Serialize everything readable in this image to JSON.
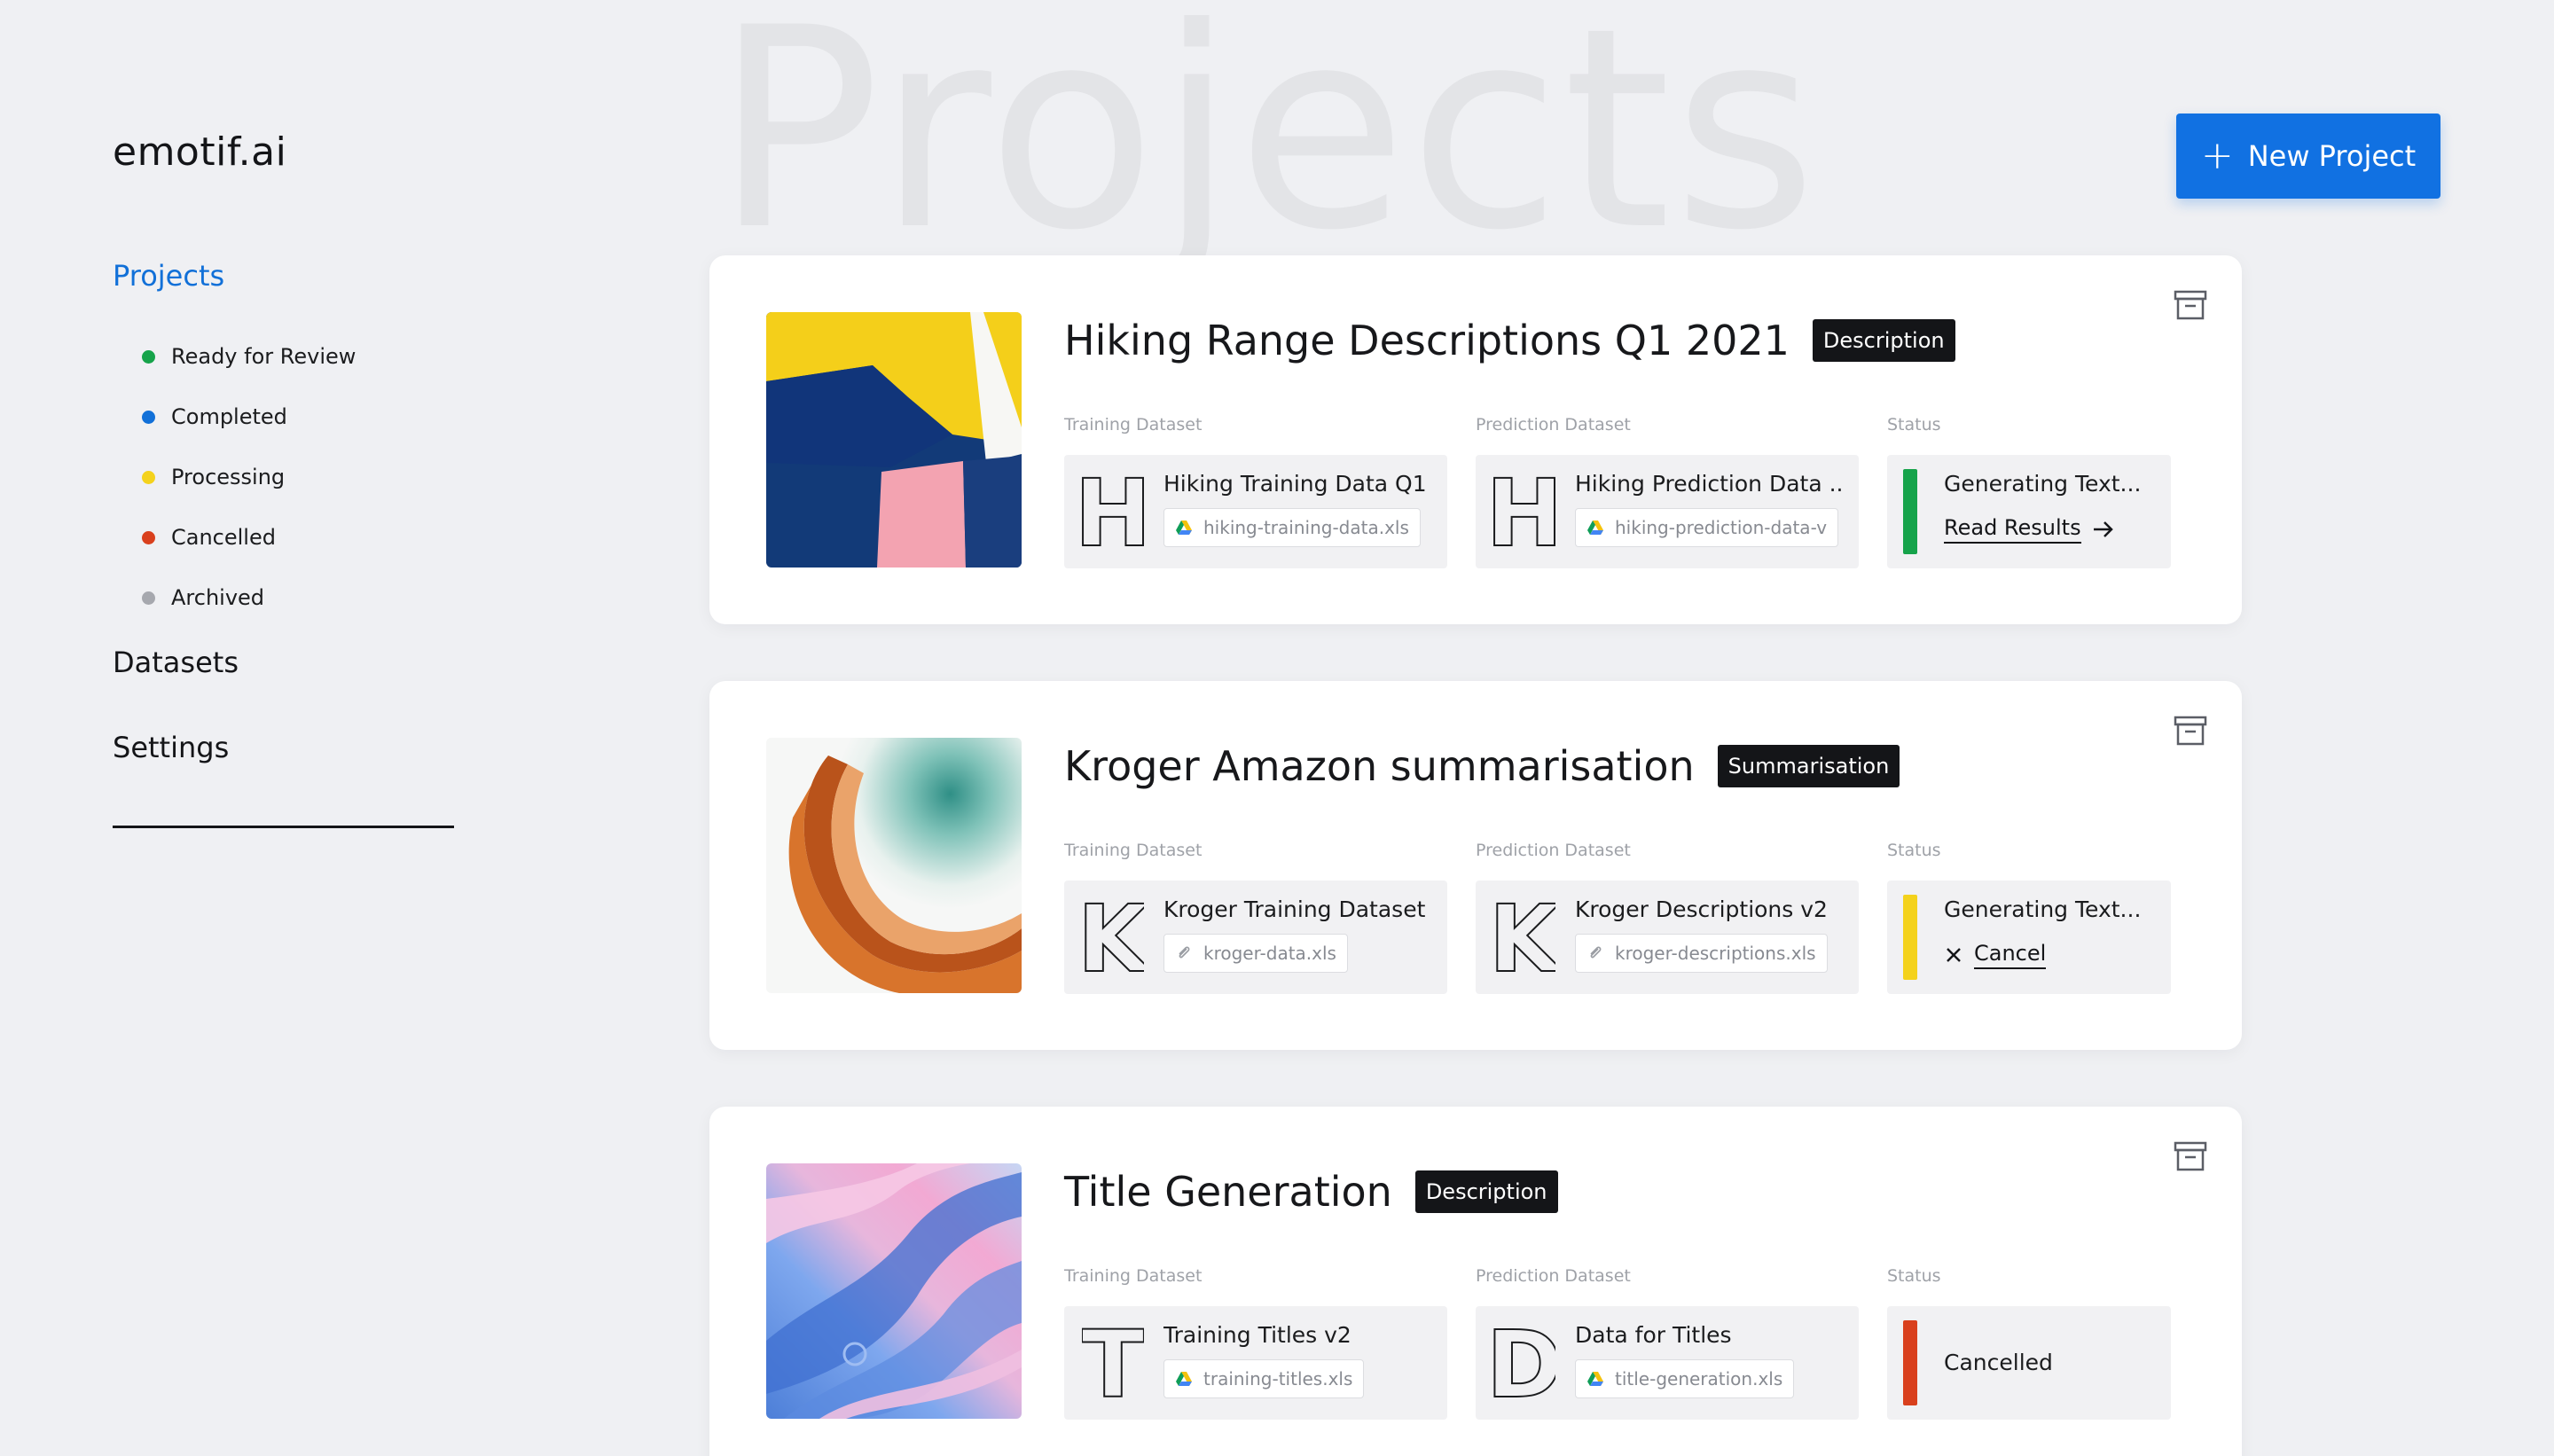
{
  "brand": "emotif.ai",
  "page_title": "Projects",
  "new_project_label": "New Project",
  "nav": {
    "projects": "Projects",
    "filters": [
      {
        "label": "Ready for Review",
        "color": "#16a34a"
      },
      {
        "label": "Completed",
        "color": "#1170d8"
      },
      {
        "label": "Processing",
        "color": "#f4d21c"
      },
      {
        "label": "Cancelled",
        "color": "#d9401d"
      },
      {
        "label": "Archived",
        "color": "#a6a8ae"
      }
    ],
    "datasets": "Datasets",
    "settings": "Settings"
  },
  "labels": {
    "training": "Training Dataset",
    "prediction": "Prediction Dataset",
    "status": "Status"
  },
  "projects": [
    {
      "title": "Hiking Range Descriptions Q1 2021",
      "tag": "Description",
      "training": {
        "letter": "H",
        "name": "Hiking Training Data Q1 ...",
        "file": "hiking-training-data.xls",
        "file_icon": "google-drive-icon"
      },
      "prediction": {
        "letter": "H",
        "name": "Hiking Prediction Data ...",
        "file": "hiking-prediction-data-v",
        "file_icon": "google-drive-icon"
      },
      "status": {
        "text": "Generating Text...",
        "color": "#16a34a",
        "action": "Read Results",
        "action_icon": "arrow-right-icon"
      }
    },
    {
      "title": "Kroger Amazon summarisation",
      "tag": "Summarisation",
      "training": {
        "letter": "K",
        "name": "Kroger Training Dataset",
        "file": "kroger-data.xls",
        "file_icon": "paperclip-icon"
      },
      "prediction": {
        "letter": "K",
        "name": "Kroger Descriptions v2",
        "file": "kroger-descriptions.xls",
        "file_icon": "paperclip-icon"
      },
      "status": {
        "text": "Generating Text...",
        "color": "#f4d21c",
        "action": "Cancel",
        "action_icon": "close-icon"
      }
    },
    {
      "title": "Title Generation",
      "tag": "Description",
      "training": {
        "letter": "T",
        "name": "Training Titles v2",
        "file": "training-titles.xls",
        "file_icon": "google-drive-icon"
      },
      "prediction": {
        "letter": "D",
        "name": "Data for Titles",
        "file": "title-generation.xls",
        "file_icon": "google-drive-icon"
      },
      "status": {
        "text": "Cancelled",
        "color": "#d9401d",
        "action": "",
        "action_icon": ""
      }
    }
  ]
}
